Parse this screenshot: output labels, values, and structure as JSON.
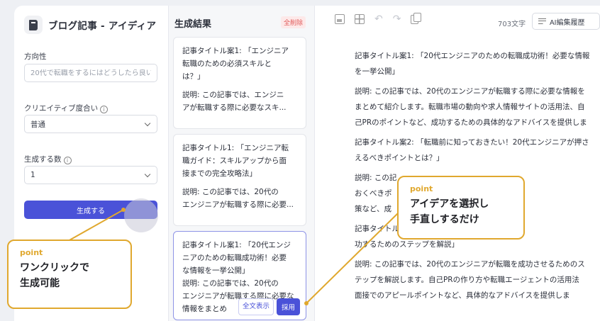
{
  "left_panel": {
    "title": "ブログ記事 - アイディア",
    "direction": {
      "label": "方向性",
      "placeholder": "20代で転職をするにはどうしたら良い"
    },
    "creativity": {
      "label": "クリエイティブ度合い",
      "value": "普通"
    },
    "count": {
      "label": "生成する数",
      "value": "1"
    },
    "generate_label": "生成する"
  },
  "middle_panel": {
    "title": "生成結果",
    "delete_all_label": "全削除",
    "cards": [
      {
        "title_lines": [
          "記事タイトル案1: 「エンジニア",
          "転職のための必須スキルと",
          "は？」"
        ],
        "desc_lines": [
          "説明: この記事では、エンジニ",
          "アが転職する際に必要なスキ..."
        ]
      },
      {
        "title_lines": [
          "記事タイトル1: 「エンジニア転",
          "職ガイド：スキルアップから面",
          "接までの完全攻略法」"
        ],
        "desc_lines": [
          "説明: この記事では、20代の",
          "エンジニアが転職する際に必要..."
        ]
      },
      {
        "title_lines": [
          "記事タイトル案1: 「20代エンジ",
          "ニアのための転職成功術！必要",
          "な情報を一挙公開」"
        ],
        "desc_lines": [
          "説明: この記事では、20代の",
          "エンジニアが転職する際に必要な",
          "情報をまとめ"
        ]
      }
    ],
    "fulltext_label": "全文表示",
    "adopt_label": "採用"
  },
  "right_panel": {
    "char_count": "703文字",
    "history_label": "AI編集履歴",
    "paragraphs": [
      [
        "記事タイトル案1: 「20代エンジニアのための転職成功術！必要な情報",
        "を一挙公開」"
      ],
      [
        "説明: この記事では、20代のエンジニアが転職する際に必要な情報を",
        "まとめて紹介します。転職市場の動向や求人情報サイトの活用法、自",
        "己PRのポイントなど、成功するための具体的なアドバイスを提供しま"
      ],
      [
        "記事タイトル案2: 「転職前に知っておきたい！20代エンジニアが押さ",
        "えるべきポイントとは？」"
      ],
      [
        "説明: この記",
        "おくべきポ",
        "策など、成"
      ],
      [
        "記事タイトル案",
        "功するためのステップを解説」"
      ],
      [
        "説明: この記事では、20代のエンジニアが転職を成功させるためのス",
        "テップを解説します。自己PRの作り方や転職エージェントの活用法",
        "面接でのアピールポイントなど、具体的なアドバイスを提供しま"
      ]
    ]
  },
  "callouts": {
    "left": {
      "point": "point",
      "message_lines": [
        "ワンクリックで",
        "生成可能"
      ]
    },
    "right": {
      "point": "point",
      "message_lines": [
        "アイデアを選択し",
        "手直しするだけ"
      ]
    }
  },
  "colors": {
    "accent": "#4a52d8",
    "callout": "#e0a82e",
    "danger": "#e15a5a"
  }
}
